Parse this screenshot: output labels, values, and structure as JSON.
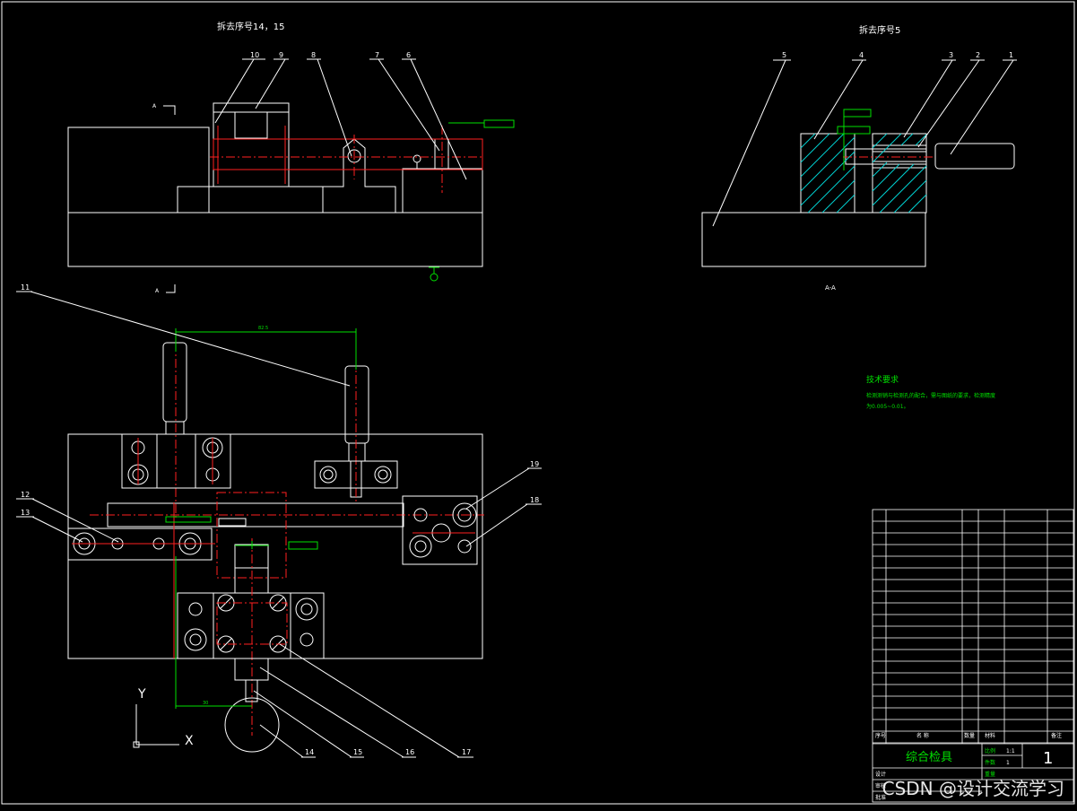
{
  "titles": {
    "left_view": "拆去序号14，15",
    "right_view": "拆去序号5",
    "section": "A-A",
    "section_mark_top": "A",
    "section_mark_bottom": "A"
  },
  "balloons": {
    "b10": "10",
    "b9": "9",
    "b8": "8",
    "b7": "7",
    "b6": "6",
    "b5": "5",
    "b4": "4",
    "b3": "3",
    "b2": "2",
    "b1": "1",
    "b11": "11",
    "b12": "12",
    "b13": "13",
    "b14": "14",
    "b15": "15",
    "b16": "16",
    "b17": "17",
    "b18": "18",
    "b19": "19"
  },
  "tech": {
    "title": "技术要求",
    "line1": "检测测销与检测孔的配合，需与图纸的要求，检测精度",
    "line2": "为0.005~0.01。"
  },
  "dims": {
    "top_span": "82.5",
    "bottom_dim": "30"
  },
  "title_block": {
    "drawing_name": "综合检具",
    "scale_label": "比例",
    "scale_value": "1:1",
    "count_label": "件数",
    "count_value": "1",
    "sheet_number": "1",
    "weight_label": "重量",
    "designer_label": "设计",
    "check_label": "审核",
    "approve_label": "批准",
    "header_seq": "序号",
    "header_name": "名 称",
    "header_qty": "数量",
    "header_material": "材料",
    "header_note": "备注"
  },
  "watermark": "CSDN @设计交流学习",
  "colors": {
    "outline": "#ffffff",
    "center": "#ff2020",
    "dim": "#00e000",
    "hatch": "#00d0d0",
    "bg": "#000000"
  }
}
